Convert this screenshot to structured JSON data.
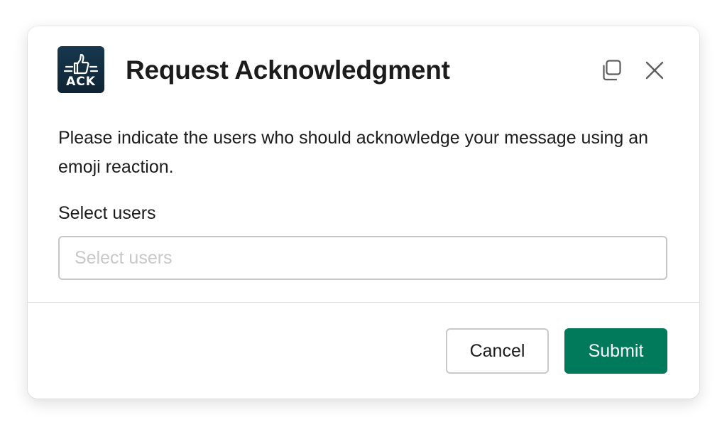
{
  "modal": {
    "title": "Request Acknowledgment",
    "logo_text": "ACK",
    "description": "Please indicate the users who should acknowledge your message using an emoji reaction.",
    "field": {
      "label": "Select users",
      "placeholder": "Select users",
      "value": ""
    },
    "buttons": {
      "cancel_label": "Cancel",
      "submit_label": "Submit"
    },
    "icons": {
      "logo": "thumbs-up-icon",
      "copy": "copy-icon",
      "close": "close-icon"
    }
  },
  "colors": {
    "primary": "#007a5a",
    "logo_background": "#122e42",
    "text": "#1d1c1d",
    "border": "#c6c6c6"
  }
}
